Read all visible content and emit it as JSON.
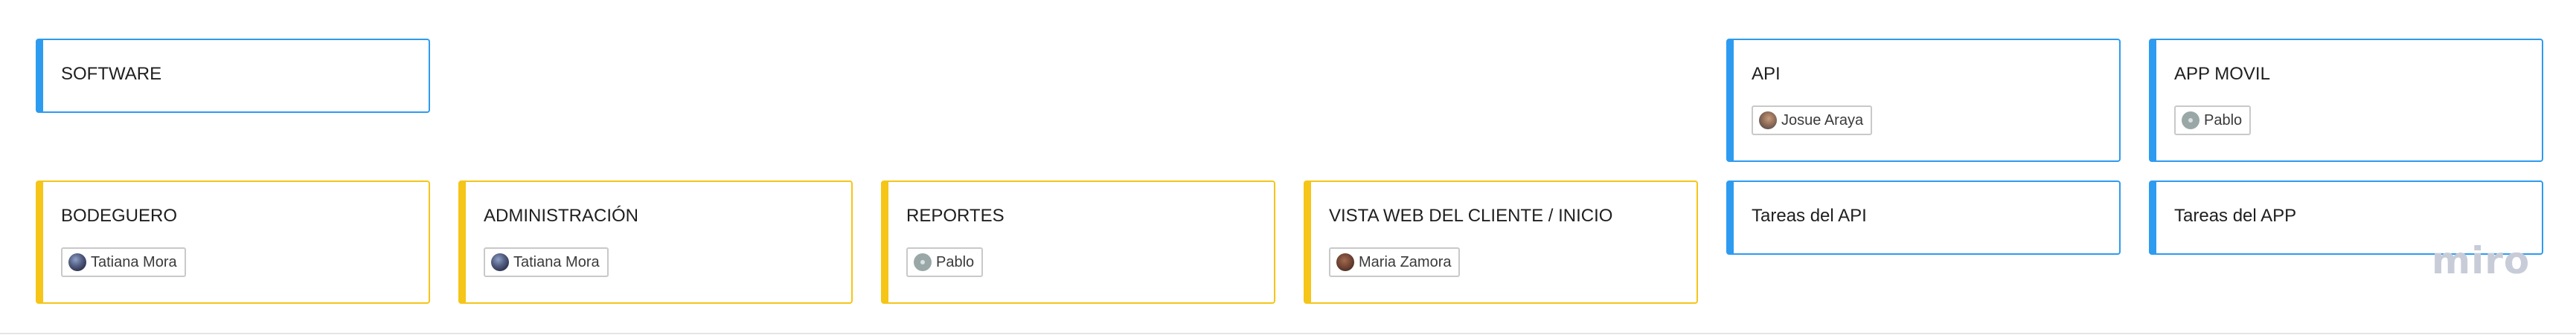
{
  "board": {
    "cards": [
      {
        "title": "SOFTWARE",
        "color": "#2d9bf0",
        "tag": null
      },
      {
        "title": "API",
        "color": "#2d9bf0",
        "tag": {
          "name": "Josue Araya",
          "avatar": "josue-avatar"
        }
      },
      {
        "title": "APP MOVIL",
        "color": "#2d9bf0",
        "tag": {
          "name": "Pablo",
          "avatar": "pablo-avatar"
        }
      },
      {
        "title": "BODEGUERO",
        "color": "#f5c518",
        "tag": {
          "name": "Tatiana Mora",
          "avatar": "tatiana-avatar"
        }
      },
      {
        "title": "ADMINISTRACIÓN",
        "color": "#f5c518",
        "tag": {
          "name": "Tatiana Mora",
          "avatar": "tatiana-avatar"
        }
      },
      {
        "title": "REPORTES",
        "color": "#f5c518",
        "tag": {
          "name": "Pablo",
          "avatar": "pablo-avatar"
        }
      },
      {
        "title": "VISTA WEB DEL CLIENTE / INICIO",
        "color": "#f5c518",
        "tag": {
          "name": "Maria Zamora",
          "avatar": "maria-avatar"
        }
      },
      {
        "title": "Tareas del API",
        "color": "#2d9bf0",
        "tag": null
      },
      {
        "title": "Tareas del APP",
        "color": "#2d9bf0",
        "tag": null
      }
    ],
    "logo_text": "miro"
  }
}
